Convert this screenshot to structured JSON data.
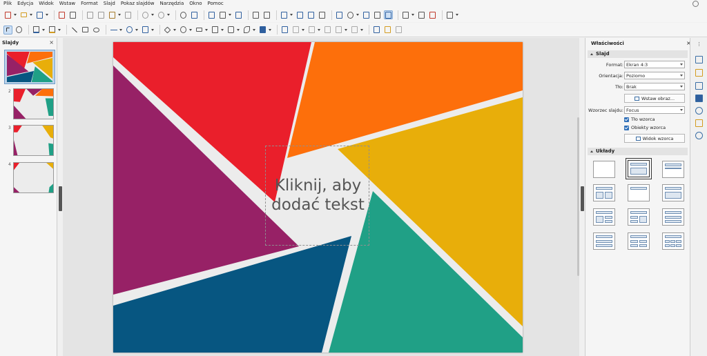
{
  "menu": [
    "Plik",
    "Edycja",
    "Widok",
    "Wstaw",
    "Format",
    "Slajd",
    "Pokaz slajdów",
    "Narzędzia",
    "Okno",
    "Pomoc"
  ],
  "slides_panel": {
    "title": "Slajdy",
    "close": "×",
    "numbers": [
      "1",
      "2",
      "3",
      "4"
    ]
  },
  "slide": {
    "placeholder_text": "Kliknij, aby dodać tekst"
  },
  "palette": {
    "red": "#ea1f2b",
    "orange": "#fd6f0b",
    "yellow": "#e8ae0a",
    "teal": "#20a086",
    "blue": "#075681",
    "purple": "#972166",
    "bg": "#ececec"
  },
  "properties": {
    "title": "Właściwości",
    "close": "×",
    "slide_section": "Slajd",
    "format_label": "Format:",
    "format_value": "Ekran 4:3",
    "orientation_label": "Orientacja:",
    "orientation_value": "Poziomo",
    "background_label": "Tło:",
    "background_value": "Brak",
    "insert_image": "Wstaw obraz...",
    "master_label": "Wzorzec slajdu:",
    "master_value": "Focus",
    "master_bg": "Tło wzorca",
    "master_objects": "Obiekty wzorca",
    "master_view": "Widok wzorca",
    "layouts_section": "Układy"
  }
}
